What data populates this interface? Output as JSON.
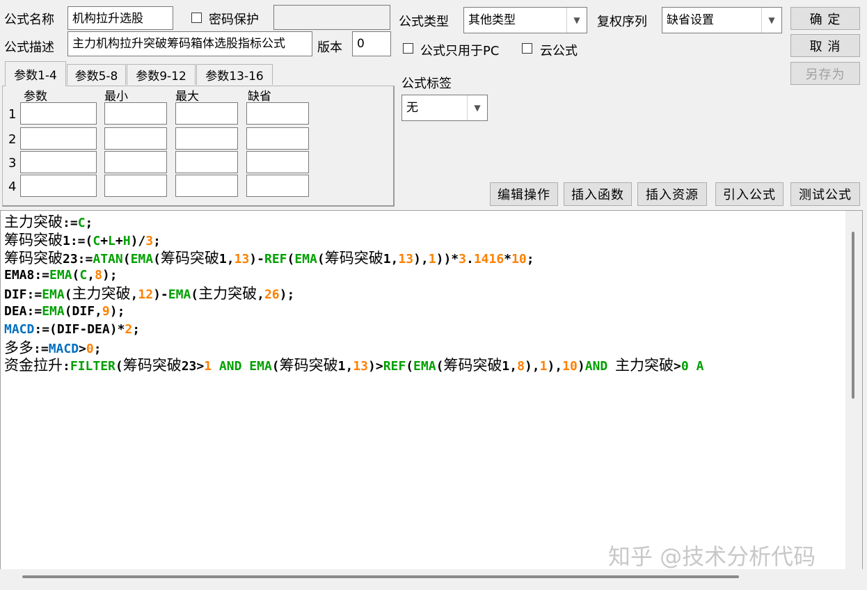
{
  "header": {
    "name_label": "公式名称",
    "name_value": "机构拉升选股",
    "password_label": "密码保护",
    "password_value": "",
    "desc_label": "公式描述",
    "desc_value": "主力机构拉升突破筹码箱体选股指标公式",
    "version_label": "版本",
    "version_value": "0",
    "type_label": "公式类型",
    "type_value": "其他类型",
    "restore_label": "复权序列",
    "restore_value": "缺省设置",
    "pc_only_label": "公式只用于PC",
    "cloud_label": "云公式",
    "tag_label": "公式标签",
    "tag_value": "无"
  },
  "buttons": {
    "ok": "确  定",
    "cancel": "取  消",
    "save_as": "另存为",
    "edit_ops": "编辑操作",
    "insert_func": "插入函数",
    "insert_res": "插入资源",
    "import_formula": "引入公式",
    "test_formula": "测试公式"
  },
  "params": {
    "tabs": [
      "参数1-4",
      "参数5-8",
      "参数9-12",
      "参数13-16"
    ],
    "columns": [
      "参数",
      "最小",
      "最大",
      "缺省"
    ],
    "rows": [
      "1",
      "2",
      "3",
      "4"
    ]
  },
  "code_colors": {
    "default": "#000000",
    "func": "#00a000",
    "number": "#ff8000",
    "var": "#0070c0",
    "chinese": "#000000"
  },
  "code": [
    [
      [
        "主力突破",
        "chinese"
      ],
      [
        ":=",
        "default"
      ],
      [
        "C",
        "func"
      ],
      [
        ";",
        "default"
      ]
    ],
    [
      [
        "筹码突破",
        "chinese"
      ],
      [
        "1:=(",
        "default"
      ],
      [
        "C",
        "func"
      ],
      [
        "+",
        "default"
      ],
      [
        "L",
        "func"
      ],
      [
        "+",
        "default"
      ],
      [
        "H",
        "func"
      ],
      [
        ")/",
        "default"
      ],
      [
        "3",
        "number"
      ],
      [
        ";",
        "default"
      ]
    ],
    [
      [
        "筹码突破",
        "chinese"
      ],
      [
        "23:=",
        "default"
      ],
      [
        "ATAN",
        "func"
      ],
      [
        "(",
        "default"
      ],
      [
        "EMA",
        "func"
      ],
      [
        "(",
        "default"
      ],
      [
        "筹码突破",
        "chinese"
      ],
      [
        "1,",
        "default"
      ],
      [
        "13",
        "number"
      ],
      [
        ")-",
        "default"
      ],
      [
        "REF",
        "func"
      ],
      [
        "(",
        "default"
      ],
      [
        "EMA",
        "func"
      ],
      [
        "(",
        "default"
      ],
      [
        "筹码突破",
        "chinese"
      ],
      [
        "1,",
        "default"
      ],
      [
        "13",
        "number"
      ],
      [
        "),",
        "default"
      ],
      [
        "1",
        "number"
      ],
      [
        "))*",
        "default"
      ],
      [
        "3",
        "number"
      ],
      [
        ".",
        "default"
      ],
      [
        "1416",
        "number"
      ],
      [
        "*",
        "default"
      ],
      [
        "10",
        "number"
      ],
      [
        ";",
        "default"
      ]
    ],
    [
      [
        "EMA8:=",
        "default"
      ],
      [
        "EMA",
        "func"
      ],
      [
        "(",
        "default"
      ],
      [
        "C",
        "func"
      ],
      [
        ",",
        "default"
      ],
      [
        "8",
        "number"
      ],
      [
        ");",
        "default"
      ]
    ],
    [
      [
        "DIF:=",
        "default"
      ],
      [
        "EMA",
        "func"
      ],
      [
        "(",
        "default"
      ],
      [
        "主力突破",
        "chinese"
      ],
      [
        ",",
        "default"
      ],
      [
        "12",
        "number"
      ],
      [
        ")-",
        "default"
      ],
      [
        "EMA",
        "func"
      ],
      [
        "(",
        "default"
      ],
      [
        "主力突破",
        "chinese"
      ],
      [
        ",",
        "default"
      ],
      [
        "26",
        "number"
      ],
      [
        ");",
        "default"
      ]
    ],
    [
      [
        "DEA:=",
        "default"
      ],
      [
        "EMA",
        "func"
      ],
      [
        "(DIF,",
        "default"
      ],
      [
        "9",
        "number"
      ],
      [
        ");",
        "default"
      ]
    ],
    [
      [
        "MACD",
        "var"
      ],
      [
        ":=(DIF-DEA)*",
        "default"
      ],
      [
        "2",
        "number"
      ],
      [
        ";",
        "default"
      ]
    ],
    [
      [
        "多多",
        "chinese"
      ],
      [
        ":=",
        "default"
      ],
      [
        "MACD",
        "var"
      ],
      [
        ">",
        "default"
      ],
      [
        "0",
        "number"
      ],
      [
        ";",
        "default"
      ]
    ],
    [
      [
        "资金拉升",
        "chinese"
      ],
      [
        ":",
        "default"
      ],
      [
        "FILTER",
        "func"
      ],
      [
        "(",
        "default"
      ],
      [
        "筹码突破",
        "chinese"
      ],
      [
        "23>",
        "default"
      ],
      [
        "1",
        "number"
      ],
      [
        " AND ",
        "func"
      ],
      [
        "EMA",
        "func"
      ],
      [
        "(",
        "default"
      ],
      [
        "筹码突破",
        "chinese"
      ],
      [
        "1,",
        "default"
      ],
      [
        "13",
        "number"
      ],
      [
        ")>",
        "default"
      ],
      [
        "REF",
        "func"
      ],
      [
        "(",
        "default"
      ],
      [
        "EMA",
        "func"
      ],
      [
        "(",
        "default"
      ],
      [
        "筹码突破",
        "chinese"
      ],
      [
        "1,",
        "default"
      ],
      [
        "8",
        "number"
      ],
      [
        "),",
        "default"
      ],
      [
        "1",
        "number"
      ],
      [
        "),",
        "default"
      ],
      [
        "10",
        "number"
      ],
      [
        ")",
        "default"
      ],
      [
        "AND",
        "func"
      ],
      [
        " ",
        "default"
      ],
      [
        "主力突破",
        "chinese"
      ],
      [
        ">",
        "default"
      ],
      [
        "0",
        "func"
      ],
      [
        " A",
        "func"
      ]
    ]
  ],
  "watermark": "知乎 @技术分析代码"
}
